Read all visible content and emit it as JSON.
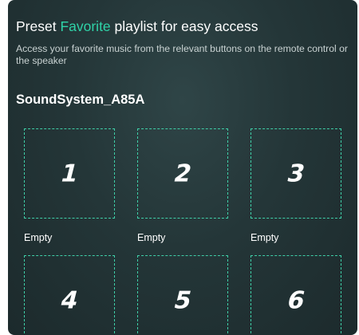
{
  "header": {
    "title_prefix": "Preset ",
    "title_accent": "Favorite",
    "title_suffix": " playlist for easy access",
    "subtitle": "Access your favorite music from the relevant buttons on the remote control or the speaker"
  },
  "device": {
    "name": "SoundSystem_A85A"
  },
  "presets": [
    {
      "number": "1",
      "status": "Empty"
    },
    {
      "number": "2",
      "status": "Empty"
    },
    {
      "number": "3",
      "status": "Empty"
    },
    {
      "number": "4"
    },
    {
      "number": "5"
    },
    {
      "number": "6"
    }
  ],
  "colors": {
    "accent": "#2fd3a8",
    "background": "#243638",
    "slot_border": "#3fcfa8"
  }
}
